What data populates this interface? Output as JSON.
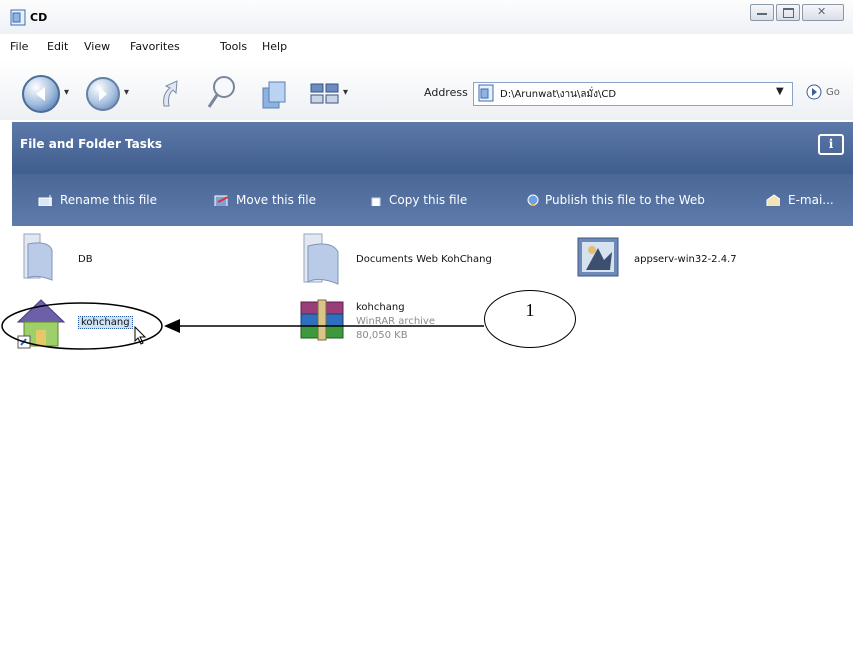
{
  "window": {
    "title": "CD",
    "controls": [
      "minimize",
      "maximize",
      "close"
    ],
    "close_glyph": "✕"
  },
  "menu": [
    "File",
    "Edit",
    "View",
    "Favorites",
    "Tools",
    "Help"
  ],
  "toolbar": {
    "back_icon": "back-arrow-icon",
    "forward_icon": "forward-arrow-icon",
    "up_icon": "up-folder-icon",
    "search_icon": "search-icon",
    "folders_icon": "folders-icon",
    "views_icon": "views-icon"
  },
  "address": {
    "label": "Address",
    "value": "D:\\Arunwat\\งาน\\ลมั่ง\\CD",
    "go_label": "Go"
  },
  "tasks": {
    "header": "File and Folder Tasks",
    "info_glyph": "i",
    "links": [
      {
        "label": "Rename this file",
        "icon": "rename-icon"
      },
      {
        "label": "Move this file",
        "icon": "move-icon"
      },
      {
        "label": "Copy this file",
        "icon": "copy-icon"
      },
      {
        "label": "Publish this file to the Web",
        "icon": "publish-icon"
      },
      {
        "label": "E-mai...",
        "icon": "email-icon"
      }
    ]
  },
  "files": [
    {
      "name": "DB",
      "type": "folder"
    },
    {
      "name": "Documents Web KohChang",
      "type": "folder"
    },
    {
      "name": "appserv-win32-2.4.7",
      "type": "installer"
    },
    {
      "name": "kohchang",
      "type": "shortcut",
      "selected": true
    },
    {
      "name": "kohchang",
      "subtitle": "WinRAR archive",
      "size": "80,050 KB",
      "type": "rar"
    }
  ],
  "annotation": {
    "number": "1"
  },
  "colors": {
    "task_header": "#4a6796",
    "task_text": "#ffffff",
    "selection": "#cde3f7"
  }
}
